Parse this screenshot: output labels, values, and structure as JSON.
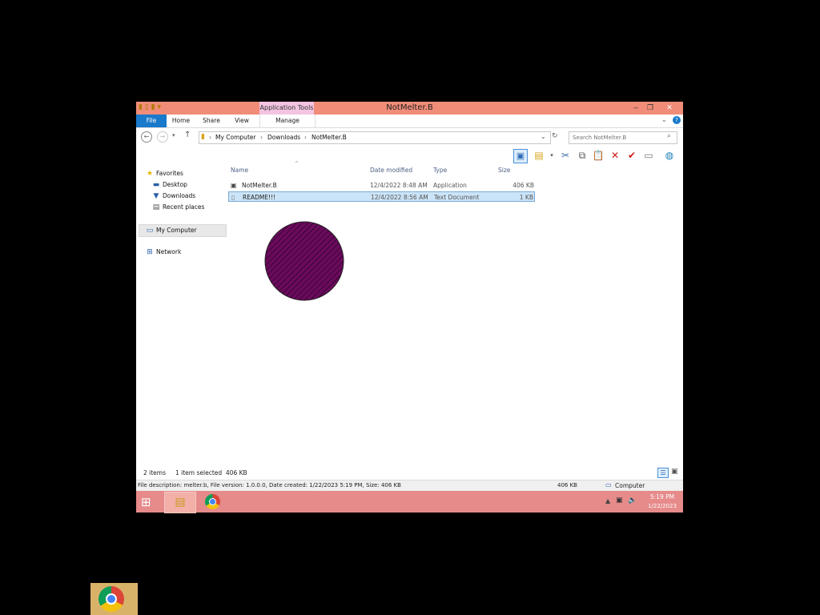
{
  "window": {
    "title": "NotMelter.B",
    "context_tab": "Application Tools"
  },
  "ribbon": {
    "tabs": [
      "File",
      "Home",
      "Share",
      "View",
      "Manage"
    ]
  },
  "address": {
    "crumbs": [
      "My Computer",
      "Downloads",
      "NotMelter.B"
    ],
    "search_placeholder": "Search NotMelter.B"
  },
  "nav": {
    "favorites": "Favorites",
    "desktop": "Desktop",
    "downloads": "Downloads",
    "recent": "Recent places",
    "computer": "My Computer",
    "network": "Network"
  },
  "files": {
    "columns": [
      "Name",
      "Date modified",
      "Type",
      "Size"
    ],
    "rows": [
      {
        "name": "NotMelter.B",
        "date": "12/4/2022 8:48 AM",
        "type": "Application",
        "size": "406 KB"
      },
      {
        "name": "README!!!",
        "date": "12/4/2022 8:56 AM",
        "type": "Text Document",
        "size": "1 KB"
      }
    ]
  },
  "status": {
    "count": "2 items",
    "selected": "1 item selected  406 KB"
  },
  "details": {
    "description": "File description: melter.b, File version: 1.0.0.0, Date created: 1/22/2023 5:19 PM, Size: 406 KB",
    "size": "406 KB",
    "location": "Computer"
  },
  "taskbar": {
    "time": "5:19 PM",
    "date": "1/22/2023"
  },
  "colors": {
    "titlebar": "#f08c78",
    "taskbar": "#e68a8a",
    "selection": "#cce4f7",
    "blob": "#6b0a5c"
  }
}
